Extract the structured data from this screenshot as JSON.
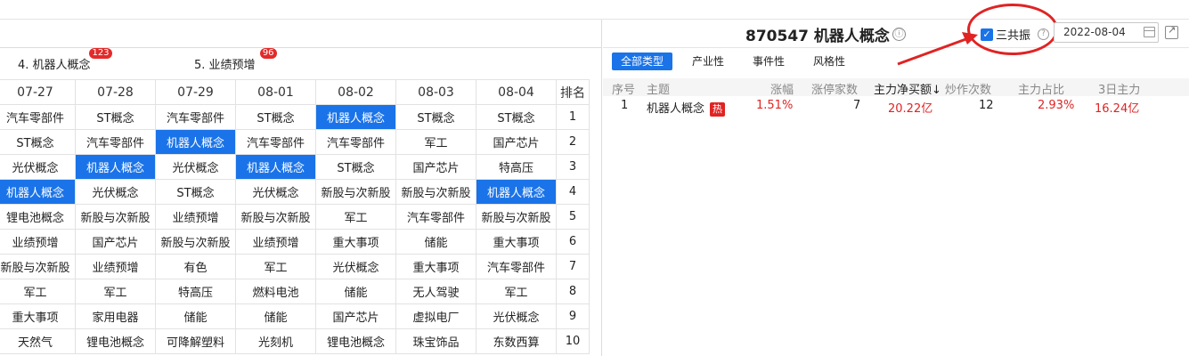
{
  "left": {
    "tags": [
      {
        "label": "4. 机器人概念",
        "badge": "123"
      },
      {
        "label": "5. 业绩预增",
        "badge": "96"
      }
    ],
    "headers": [
      "07-27",
      "07-28",
      "07-29",
      "08-01",
      "08-02",
      "08-03",
      "08-04",
      "排名"
    ],
    "rows": [
      [
        "汽车零部件",
        "ST概念",
        "汽车零部件",
        "ST概念",
        "机器人概念",
        "ST概念",
        "ST概念",
        "1"
      ],
      [
        "ST概念",
        "汽车零部件",
        "机器人概念",
        "汽车零部件",
        "汽车零部件",
        "军工",
        "国产芯片",
        "2"
      ],
      [
        "光伏概念",
        "机器人概念",
        "光伏概念",
        "机器人概念",
        "ST概念",
        "国产芯片",
        "特高压",
        "3"
      ],
      [
        "机器人概念",
        "光伏概念",
        "ST概念",
        "光伏概念",
        "新股与次新股",
        "新股与次新股",
        "机器人概念",
        "4"
      ],
      [
        "锂电池概念",
        "新股与次新股",
        "业绩预增",
        "新股与次新股",
        "军工",
        "汽车零部件",
        "新股与次新股",
        "5"
      ],
      [
        "业绩预增",
        "国产芯片",
        "新股与次新股",
        "业绩预增",
        "重大事项",
        "储能",
        "重大事项",
        "6"
      ],
      [
        "新股与次新股",
        "业绩预增",
        "有色",
        "军工",
        "光伏概念",
        "重大事项",
        "汽车零部件",
        "7"
      ],
      [
        "军工",
        "军工",
        "特高压",
        "燃料电池",
        "储能",
        "无人驾驶",
        "军工",
        "8"
      ],
      [
        "重大事项",
        "家用电器",
        "储能",
        "储能",
        "国产芯片",
        "虚拟电厂",
        "光伏概念",
        "9"
      ],
      [
        "天然气",
        "锂电池概念",
        "可降解塑料",
        "光刻机",
        "锂电池概念",
        "珠宝饰品",
        "东数西算",
        "10"
      ]
    ],
    "highlight_color": "#1a73e8"
  },
  "right": {
    "title": "870547 机器人概念",
    "info_icon": "ⓘ",
    "checkbox_label": "三共振",
    "checkbox_checked": true,
    "help_icon": "?",
    "date_value": "2022-08-04",
    "tabs": [
      "全部类型",
      "产业性",
      "事件性",
      "风格性"
    ],
    "columns": [
      "序号",
      "主题",
      "涨幅",
      "涨停家数",
      "主力净买额↓",
      "炒作次数",
      "主力占比",
      "3日主力"
    ],
    "row": {
      "idx": "1",
      "theme": "机器人概念",
      "hot": "热",
      "change": "1.51%",
      "limit_up": "7",
      "net_buy": "20.22亿",
      "count": "12",
      "ratio": "2.93%",
      "three_day": "16.24亿"
    },
    "accent_red": "#e02323"
  }
}
